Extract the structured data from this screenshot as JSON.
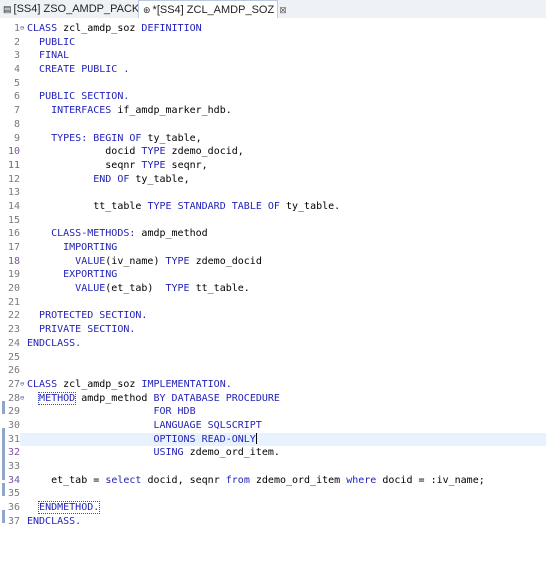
{
  "tabs": [
    {
      "label": "[SS4] ZSO_AMDP_PACK",
      "icon": "abap-class-icon"
    },
    {
      "label": "*[SS4] ZCL_AMDP_SOZ",
      "icon": "abap-class-icon",
      "close": "⊠"
    }
  ],
  "code_lines": [
    {
      "n": "1",
      "fold": "⊖",
      "t": "CLASS zcl_amdp_soz DEFINITION"
    },
    {
      "n": "2",
      "t": "  PUBLIC"
    },
    {
      "n": "3",
      "t": "  FINAL"
    },
    {
      "n": "4",
      "t": "  CREATE PUBLIC ."
    },
    {
      "n": "5",
      "t": ""
    },
    {
      "n": "6",
      "t": "  PUBLIC SECTION."
    },
    {
      "n": "7",
      "t": "    INTERFACES if_amdp_marker_hdb."
    },
    {
      "n": "8",
      "t": ""
    },
    {
      "n": "9",
      "t": "    TYPES: BEGIN OF ty_table,"
    },
    {
      "n": "10",
      "t": "             docid TYPE zdemo_docid,"
    },
    {
      "n": "11",
      "t": "             seqnr TYPE seqnr,"
    },
    {
      "n": "12",
      "t": "           END OF ty_table,"
    },
    {
      "n": "13",
      "t": ""
    },
    {
      "n": "14",
      "t": "           tt_table TYPE STANDARD TABLE OF ty_table."
    },
    {
      "n": "15",
      "t": ""
    },
    {
      "n": "16",
      "t": "    CLASS-METHODS: amdp_method"
    },
    {
      "n": "17",
      "t": "      IMPORTING"
    },
    {
      "n": "18",
      "t": "        VALUE(iv_name) TYPE zdemo_docid"
    },
    {
      "n": "19",
      "t": "      EXPORTING"
    },
    {
      "n": "20",
      "t": "        VALUE(et_tab)  TYPE tt_table."
    },
    {
      "n": "21",
      "t": ""
    },
    {
      "n": "22",
      "t": "  PROTECTED SECTION."
    },
    {
      "n": "23",
      "t": "  PRIVATE SECTION."
    },
    {
      "n": "24",
      "t": "ENDCLASS."
    },
    {
      "n": "25",
      "t": ""
    },
    {
      "n": "26",
      "t": ""
    },
    {
      "n": "27",
      "fold": "⊖",
      "t": "CLASS zcl_amdp_soz IMPLEMENTATION."
    },
    {
      "n": "28",
      "fold": "⊖",
      "t": "  METHOD amdp_method BY DATABASE PROCEDURE"
    },
    {
      "n": "29",
      "t": "                     FOR HDB"
    },
    {
      "n": "30",
      "t": "                     LANGUAGE SQLSCRIPT"
    },
    {
      "n": "31",
      "t": "                     OPTIONS READ-ONLY"
    },
    {
      "n": "32",
      "t": "                     USING zdemo_ord_item."
    },
    {
      "n": "33",
      "t": ""
    },
    {
      "n": "34",
      "t": "    et_tab = select docid, seqnr from zdemo_ord_item where docid = :iv_name;"
    },
    {
      "n": "35",
      "t": ""
    },
    {
      "n": "36",
      "t": "  ENDMETHOD."
    },
    {
      "n": "37",
      "t": "ENDCLASS."
    }
  ]
}
